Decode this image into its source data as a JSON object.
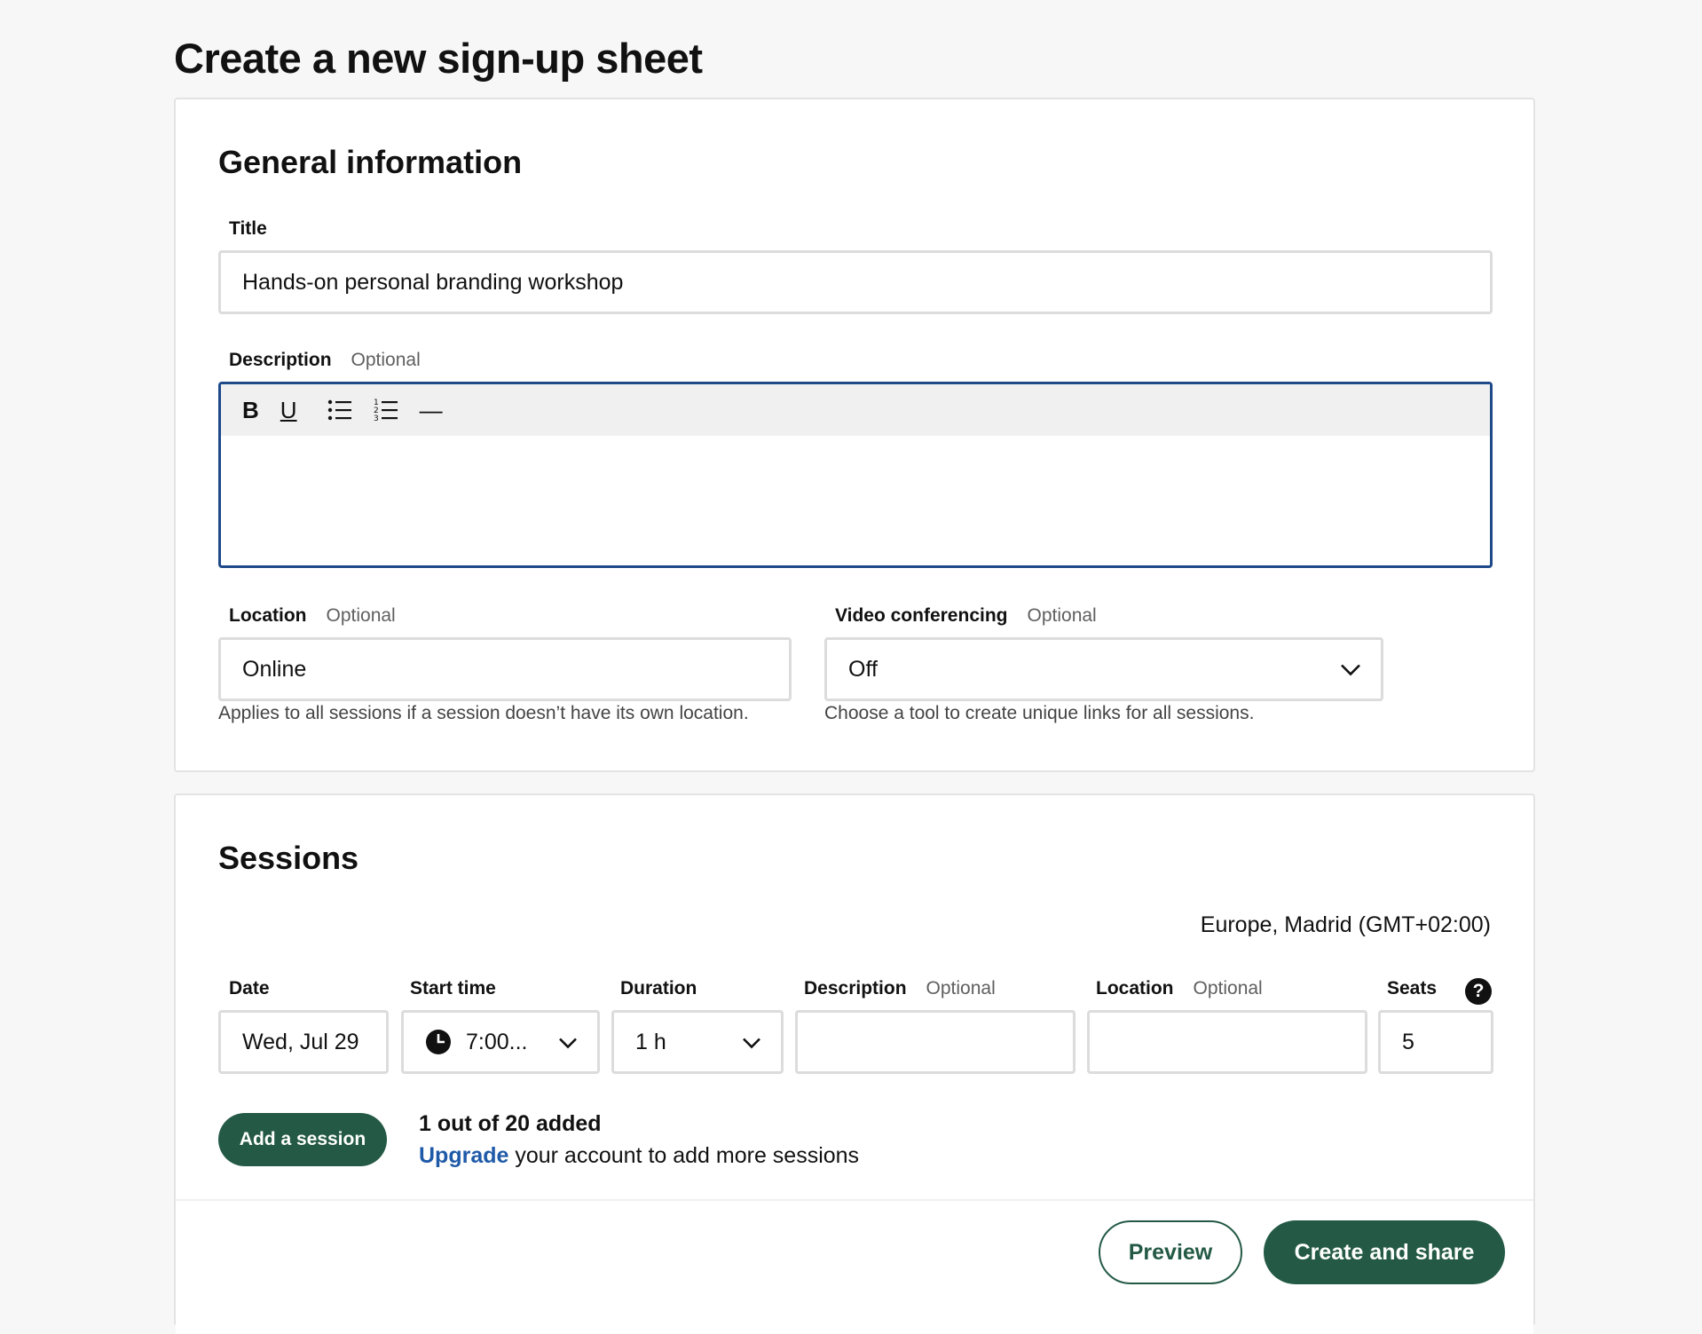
{
  "page_title": "Create a new sign-up sheet",
  "general": {
    "section_title": "General information",
    "title_label": "Title",
    "title_value": "Hands-on personal branding workshop",
    "description_label": "Description",
    "description_optional": "Optional",
    "toolbar": {
      "bold": "B",
      "underline": "U",
      "bullet_list_icon": "bulleted-list-icon",
      "numbered_list_icon": "numbered-list-icon",
      "horizontal_rule": "—"
    },
    "location_label": "Location",
    "location_optional": "Optional",
    "location_value": "Online",
    "location_helper": "Applies to all sessions if a session doesn’t have its own location.",
    "video_label": "Video conferencing",
    "video_optional": "Optional",
    "video_value": "Off",
    "video_helper": "Choose a tool to create unique links for all sessions."
  },
  "sessions": {
    "section_title": "Sessions",
    "timezone": "Europe, Madrid (GMT+02:00)",
    "columns": {
      "date": "Date",
      "start_time": "Start time",
      "duration": "Duration",
      "description": "Description",
      "description_optional": "Optional",
      "location": "Location",
      "location_optional": "Optional",
      "seats": "Seats"
    },
    "row": {
      "date": "Wed, Jul 29",
      "start_time": "7:00...",
      "duration": "1 h",
      "description": "",
      "location": "",
      "seats": "5"
    },
    "add_button": "Add a session",
    "count_text": "1 out of 20 added",
    "upgrade_link": "Upgrade",
    "upgrade_text": " your account to add more sessions"
  },
  "footer": {
    "preview": "Preview",
    "create": "Create and share"
  },
  "colors": {
    "primary": "#245a45",
    "link": "#1f5aa8",
    "focus_border": "#1f4a8a"
  }
}
